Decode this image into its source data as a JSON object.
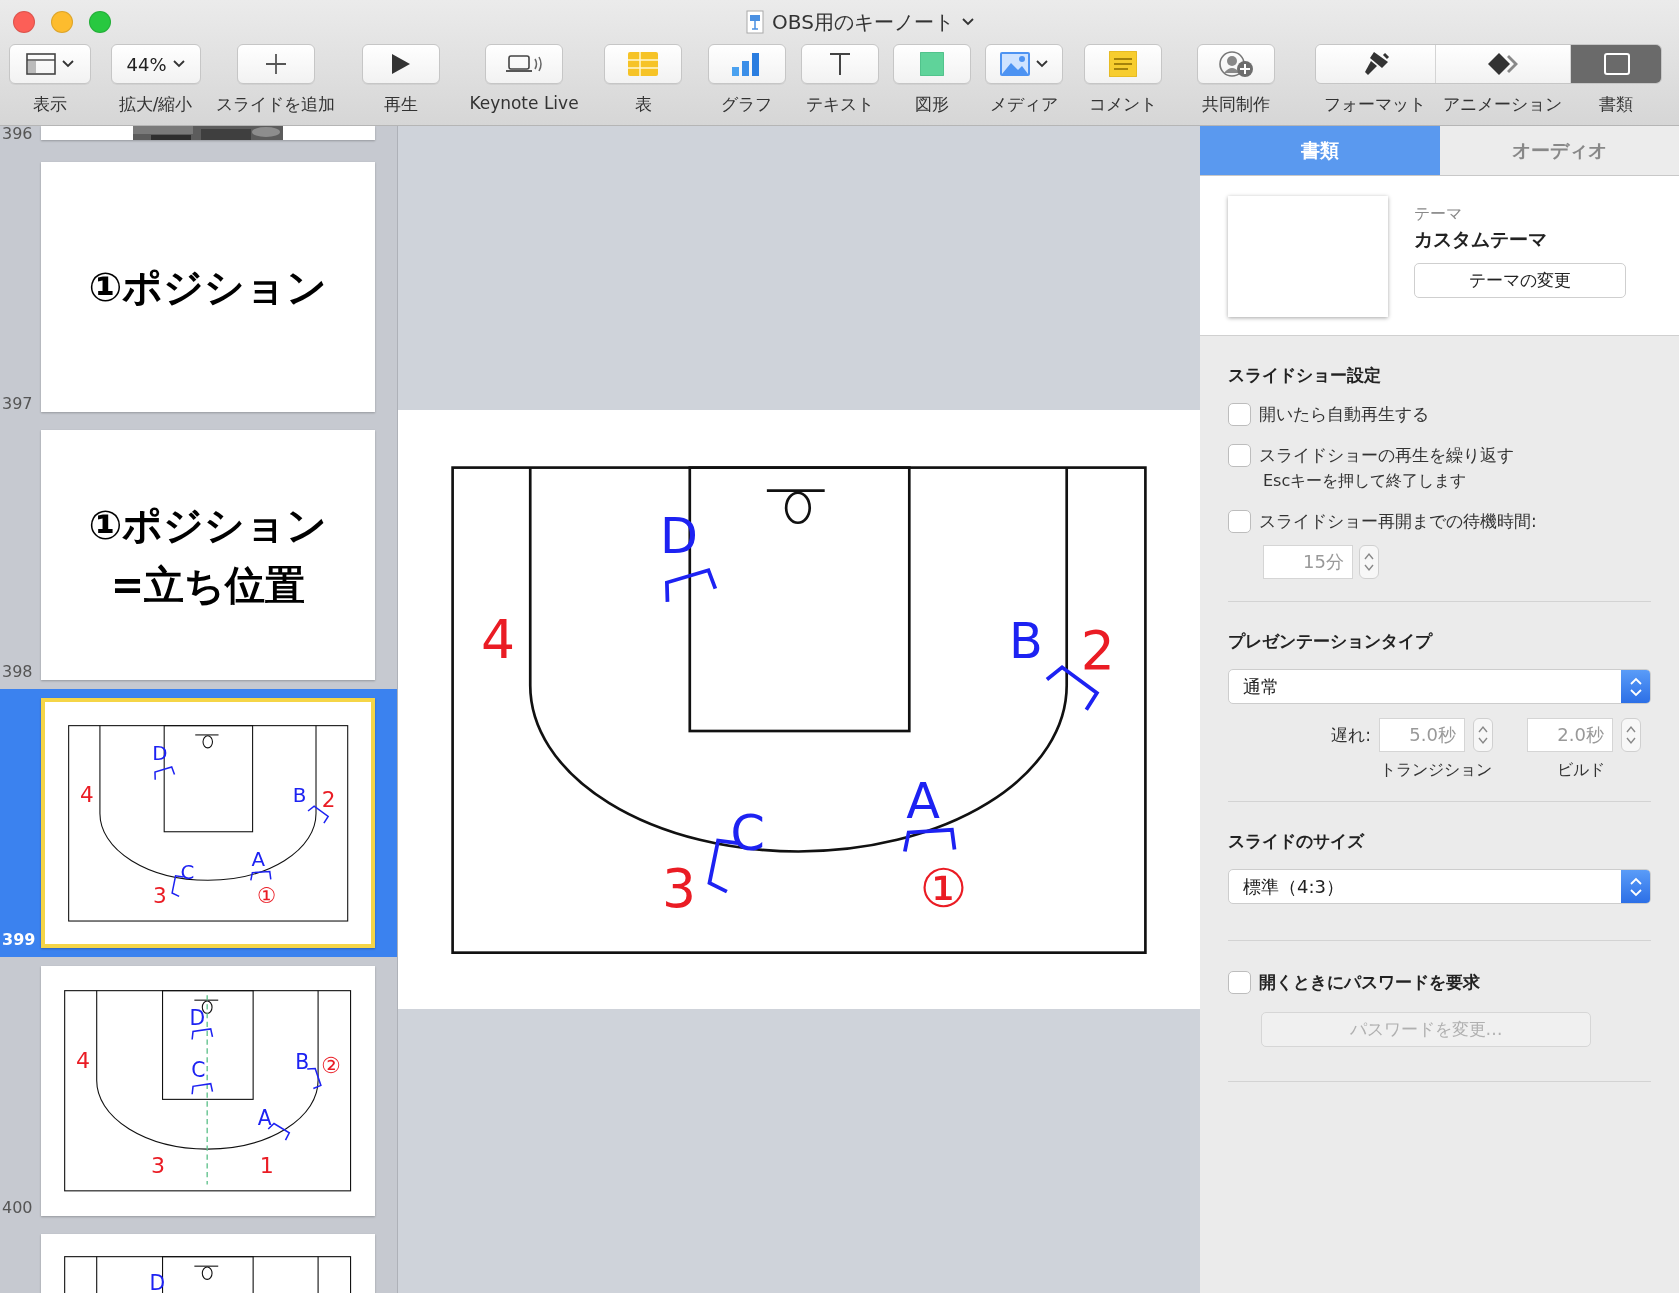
{
  "window": {
    "title": "OBS用のキーノート"
  },
  "toolbar": [
    {
      "kind": "view",
      "label": "表示"
    },
    {
      "kind": "zoom",
      "label": "拡大/縮小",
      "value": "44%"
    },
    {
      "kind": "add",
      "label": "スライドを追加"
    },
    {
      "kind": "play",
      "label": "再生"
    },
    {
      "kind": "live",
      "label": "Keynote Live"
    },
    {
      "kind": "table",
      "label": "表"
    },
    {
      "kind": "chart",
      "label": "グラフ"
    },
    {
      "kind": "text",
      "label": "テキスト"
    },
    {
      "kind": "shape",
      "label": "図形"
    },
    {
      "kind": "media",
      "label": "メディア"
    },
    {
      "kind": "comment",
      "label": "コメント"
    },
    {
      "kind": "collaborate",
      "label": "共同制作"
    }
  ],
  "format_tabs": [
    {
      "kind": "format",
      "label": "フォーマット",
      "selected": false
    },
    {
      "kind": "animate",
      "label": "アニメーション",
      "selected": false
    },
    {
      "kind": "document",
      "label": "書類",
      "selected": true
    }
  ],
  "slides": [
    {
      "number": "396",
      "kind": "picture",
      "selected": false
    },
    {
      "number": "397",
      "kind": "title",
      "lines": [
        "①ポジション"
      ],
      "selected": false
    },
    {
      "number": "398",
      "kind": "title",
      "lines": [
        "①ポジション",
        "=立ち位置"
      ],
      "selected": false
    },
    {
      "number": "399",
      "kind": "court",
      "selected": true,
      "marks": [
        {
          "text": "D",
          "kind": "defense"
        },
        {
          "text": "4",
          "kind": "offense"
        },
        {
          "text": "B",
          "kind": "defense"
        },
        {
          "text": "2",
          "kind": "offense"
        },
        {
          "text": "C",
          "kind": "defense"
        },
        {
          "text": "3",
          "kind": "offense"
        },
        {
          "text": "A",
          "kind": "defense"
        },
        {
          "text": "①",
          "kind": "offense"
        }
      ]
    },
    {
      "number": "400",
      "kind": "court",
      "selected": false,
      "marks": [
        {
          "text": "D",
          "kind": "defense"
        },
        {
          "text": "4",
          "kind": "offense"
        },
        {
          "text": "C",
          "kind": "defense"
        },
        {
          "text": "B",
          "kind": "defense"
        },
        {
          "text": "②",
          "kind": "offense"
        },
        {
          "text": "A",
          "kind": "defense"
        },
        {
          "text": "3",
          "kind": "offense"
        },
        {
          "text": "1",
          "kind": "offense"
        }
      ]
    },
    {
      "kind": "court",
      "selected": false,
      "marks": [
        {
          "text": "D",
          "kind": "defense"
        }
      ]
    }
  ],
  "canvas": {
    "marks": [
      {
        "text": "D",
        "kind": "defense"
      },
      {
        "text": "4",
        "kind": "offense"
      },
      {
        "text": "B",
        "kind": "defense"
      },
      {
        "text": "2",
        "kind": "offense"
      },
      {
        "text": "C",
        "kind": "defense"
      },
      {
        "text": "3",
        "kind": "offense"
      },
      {
        "text": "A",
        "kind": "defense"
      },
      {
        "text": "①",
        "kind": "offense"
      }
    ]
  },
  "inspector": {
    "tabs": [
      {
        "label": "書類",
        "selected": true
      },
      {
        "label": "オーディオ",
        "selected": false
      }
    ],
    "theme": {
      "caption": "テーマ",
      "name": "カスタムテーマ",
      "button": "テーマの変更"
    },
    "slideshow": {
      "heading": "スライドショー設定",
      "options": [
        {
          "label": "開いたら自動再生する",
          "checked": false
        },
        {
          "label": "スライドショーの再生を繰り返す",
          "note": "Escキーを押して終了します",
          "checked": false
        },
        {
          "label": "スライドショー再開までの待機時間:",
          "checked": false
        }
      ],
      "idle_time": "15分"
    },
    "presentation": {
      "heading": "プレゼンテーションタイプ",
      "type": "通常",
      "delay_label": "遅れ:",
      "transition": "5.0秒",
      "build": "2.0秒",
      "transition_caption": "トランジション",
      "build_caption": "ビルド"
    },
    "size": {
      "heading": "スライドのサイズ",
      "value": "標準（4:3）"
    },
    "password": {
      "label": "開くときにパスワードを要求",
      "checked": false,
      "button": "パスワードを変更…",
      "disabled": true
    }
  }
}
